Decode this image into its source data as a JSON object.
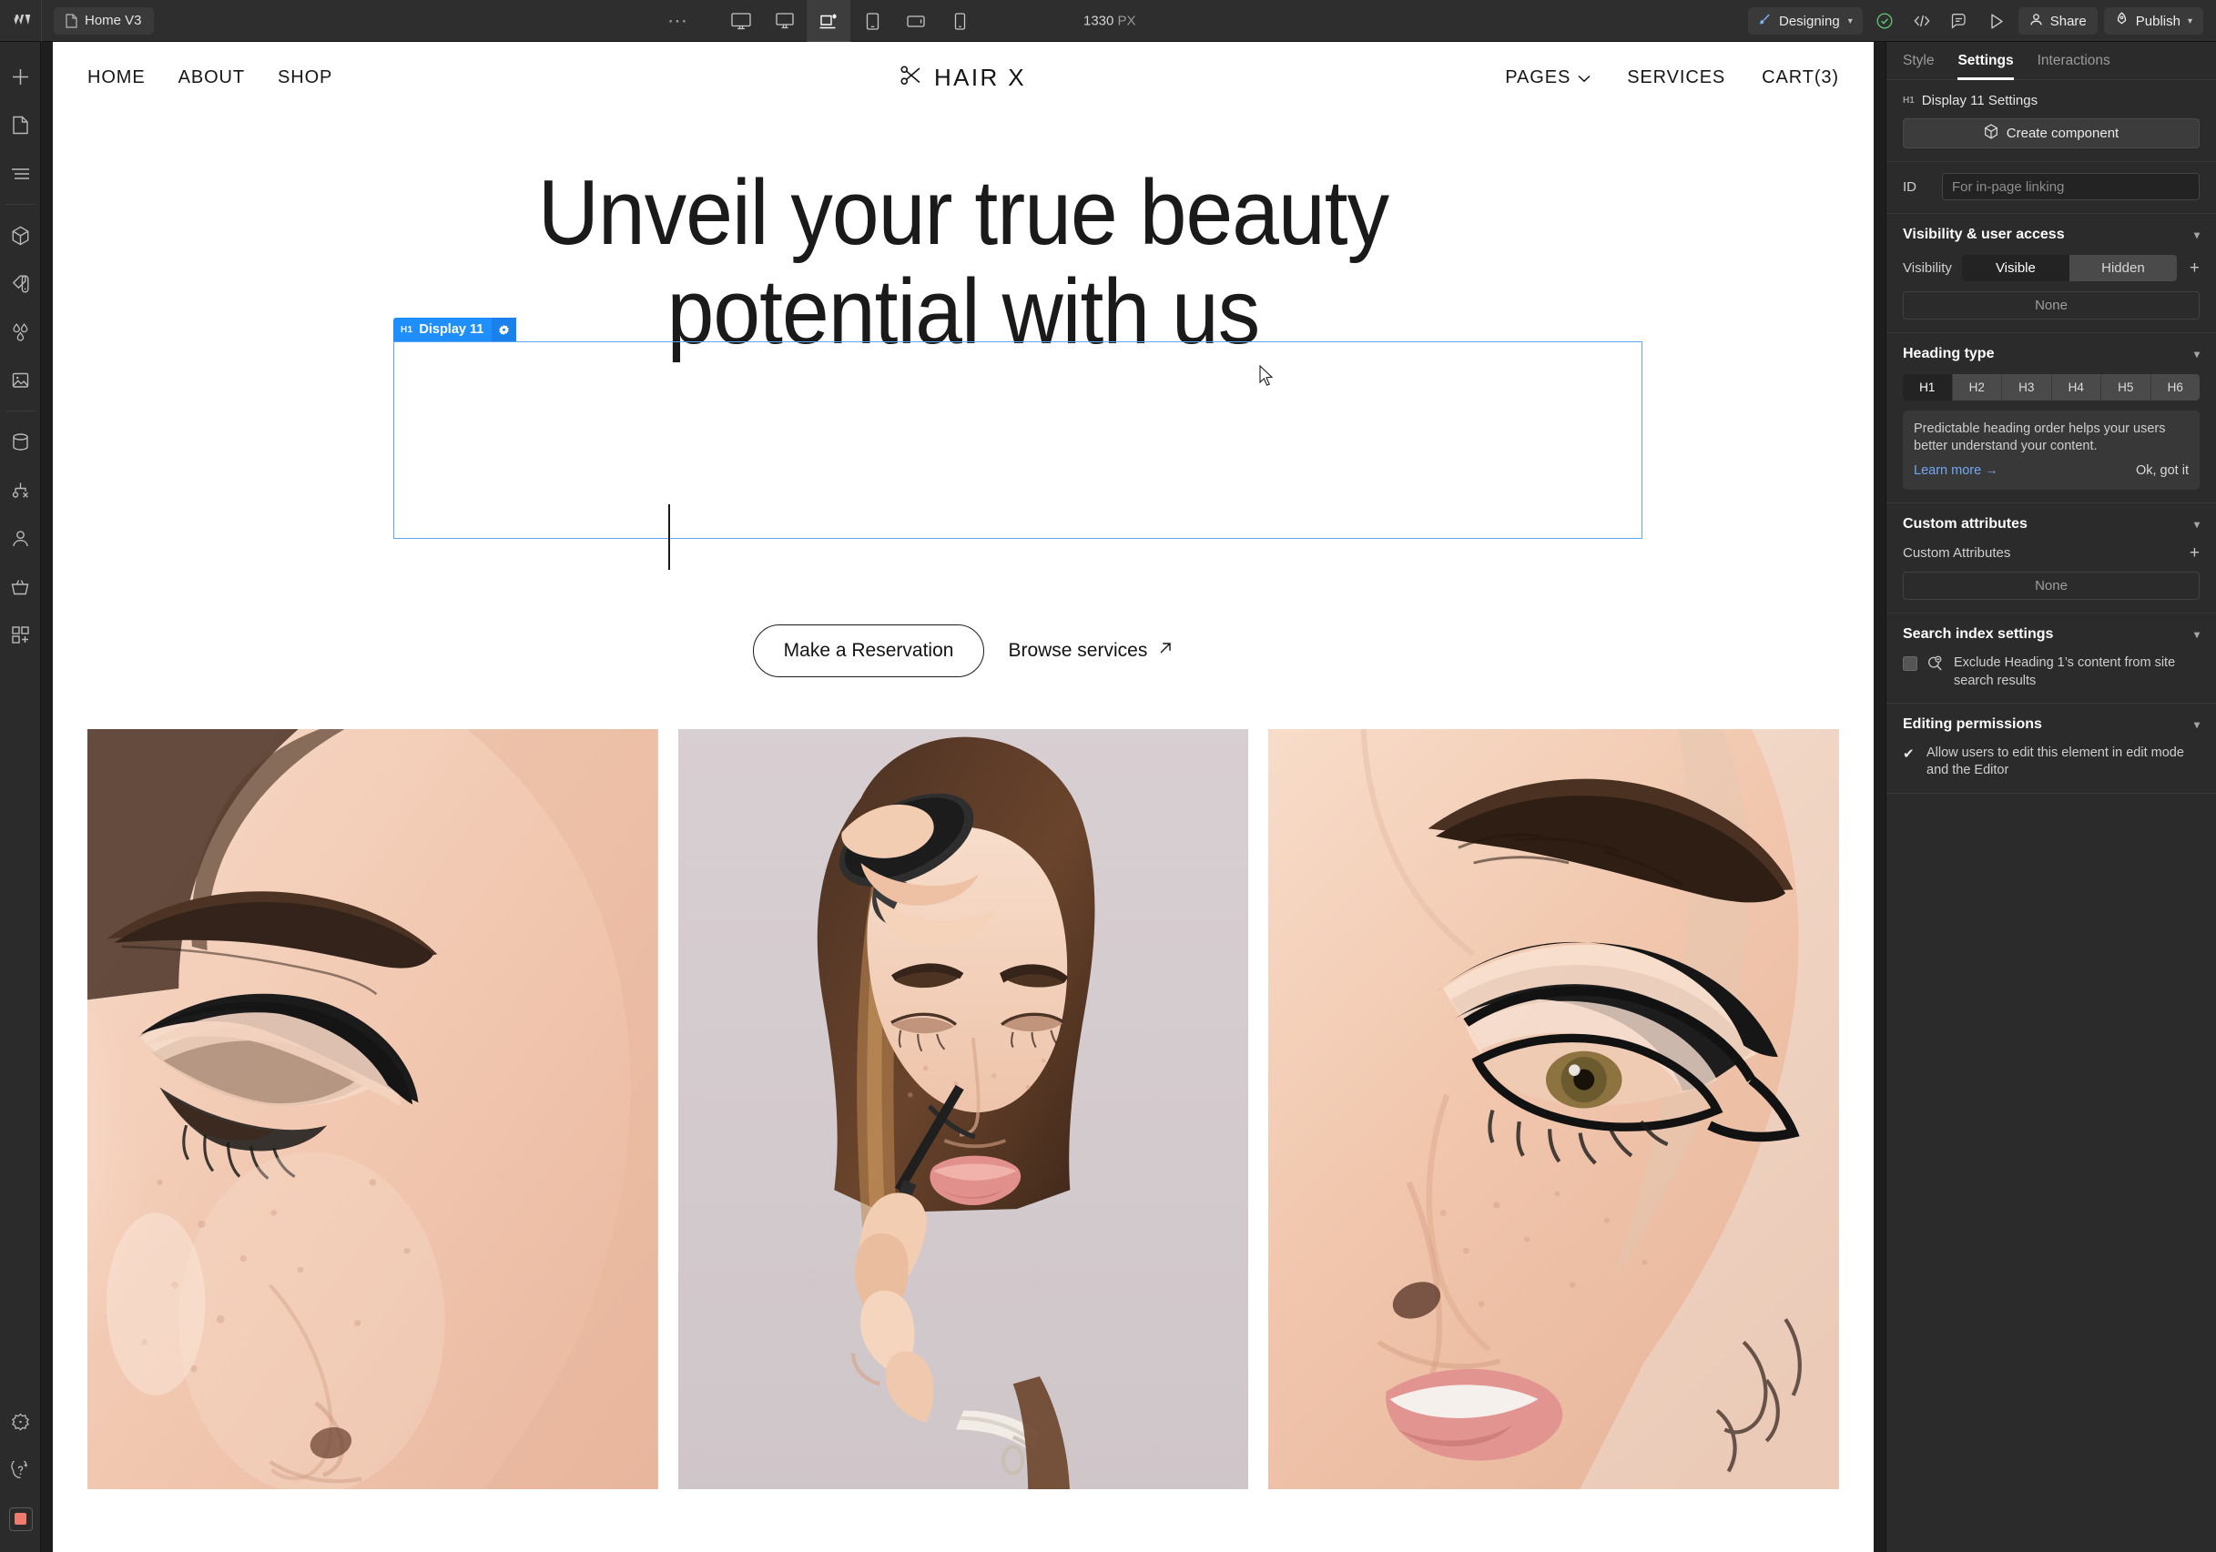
{
  "topbar": {
    "logo": "webflow-logo",
    "page_tab": "Home V3",
    "more_label": "⋯",
    "devices": [
      {
        "name": "desktop-large",
        "active": false
      },
      {
        "name": "desktop",
        "active": false
      },
      {
        "name": "base-breakpoint",
        "active": true
      },
      {
        "name": "tablet",
        "active": false
      },
      {
        "name": "mobile-landscape",
        "active": false
      },
      {
        "name": "mobile-portrait",
        "active": false
      }
    ],
    "viewport_size": "1330",
    "viewport_unit": "PX",
    "mode_label": "Designing",
    "quick_icons": [
      "check-circle-icon",
      "code-icon",
      "comment-icon",
      "preview-play-icon"
    ],
    "share_label": "Share",
    "publish_label": "Publish"
  },
  "left_rail": {
    "items": [
      {
        "name": "add-elements-icon"
      },
      {
        "name": "pages-icon"
      },
      {
        "name": "navigator-icon"
      },
      {
        "name": "components-icon"
      },
      {
        "name": "style-selectors-icon"
      },
      {
        "name": "variables-icon"
      },
      {
        "name": "assets-icon"
      },
      {
        "name": "cms-icon"
      },
      {
        "name": "logic-icon"
      },
      {
        "name": "users-icon"
      },
      {
        "name": "ecommerce-icon"
      },
      {
        "name": "apps-icon"
      }
    ],
    "bottom_items": [
      {
        "name": "settings-gear-icon"
      },
      {
        "name": "help-ai-icon"
      },
      {
        "name": "record-icon"
      }
    ]
  },
  "site": {
    "nav_left": [
      "HOME",
      "ABOUT",
      "SHOP"
    ],
    "brand": "HAIR X",
    "brand_icon": "scissors-icon",
    "nav_right": [
      {
        "label": "PAGES",
        "caret": true
      },
      {
        "label": "SERVICES",
        "caret": false
      },
      {
        "label": "CART(3)",
        "caret": false
      }
    ],
    "hero": {
      "heading_line1": "Unveil your true beauty",
      "heading_line2": "potential with us",
      "primary_cta": "Make a Reservation",
      "secondary_cta": "Browse services",
      "secondary_cta_icon": "arrow-up-right-icon"
    },
    "gallery": [
      {
        "alt": "close-up eye with graphic black eyeliner"
      },
      {
        "alt": "makeup artist applying eyeliner to model"
      },
      {
        "alt": "close-up face with winged eyeliner"
      }
    ]
  },
  "selection": {
    "tag": "H1",
    "label": "Display 11",
    "gear_icon": "gear-icon"
  },
  "right_panel": {
    "tabs": [
      {
        "label": "Style",
        "active": false
      },
      {
        "label": "Settings",
        "active": true
      },
      {
        "label": "Interactions",
        "active": false
      }
    ],
    "element_tag": "H1",
    "element_title": "Display 11 Settings",
    "create_component_label": "Create component",
    "create_component_icon": "component-cube-icon",
    "id_label": "ID",
    "id_placeholder": "For in-page linking",
    "visibility": {
      "section_title": "Visibility & user access",
      "field_label": "Visibility",
      "options": [
        {
          "label": "Visible",
          "selected": true
        },
        {
          "label": "Hidden",
          "selected": false
        }
      ],
      "add_icon": "plus-icon",
      "access_value": "None"
    },
    "heading_type": {
      "section_title": "Heading type",
      "options": [
        {
          "label": "H1",
          "selected": true
        },
        {
          "label": "H2",
          "selected": false
        },
        {
          "label": "H3",
          "selected": false
        },
        {
          "label": "H4",
          "selected": false
        },
        {
          "label": "H5",
          "selected": false
        },
        {
          "label": "H6",
          "selected": false
        }
      ],
      "tip_text": "Predictable heading order helps your users better understand your content.",
      "learn_more": "Learn more →",
      "dismiss": "Ok, got it"
    },
    "custom_attributes": {
      "section_title": "Custom attributes",
      "field_label": "Custom Attributes",
      "add_icon": "plus-icon",
      "value": "None"
    },
    "search_index": {
      "section_title": "Search index settings",
      "checkbox_icon": "search-exclude-icon",
      "checkbox_label": "Exclude Heading 1’s content from site search results",
      "checked": false
    },
    "editing_permissions": {
      "section_title": "Editing permissions",
      "checkbox_label": "Allow users to edit this element in edit mode and the Editor",
      "checked": true
    }
  },
  "colors": {
    "accent_blue": "#1f8fff",
    "panel_bg": "#2b2b2b",
    "topbar_bg": "#2e2e2e",
    "canvas_bg": "#ffffff",
    "link_blue": "#6fa8f5",
    "record_red": "#ef7b6e",
    "ok_green": "#5fbf72"
  }
}
